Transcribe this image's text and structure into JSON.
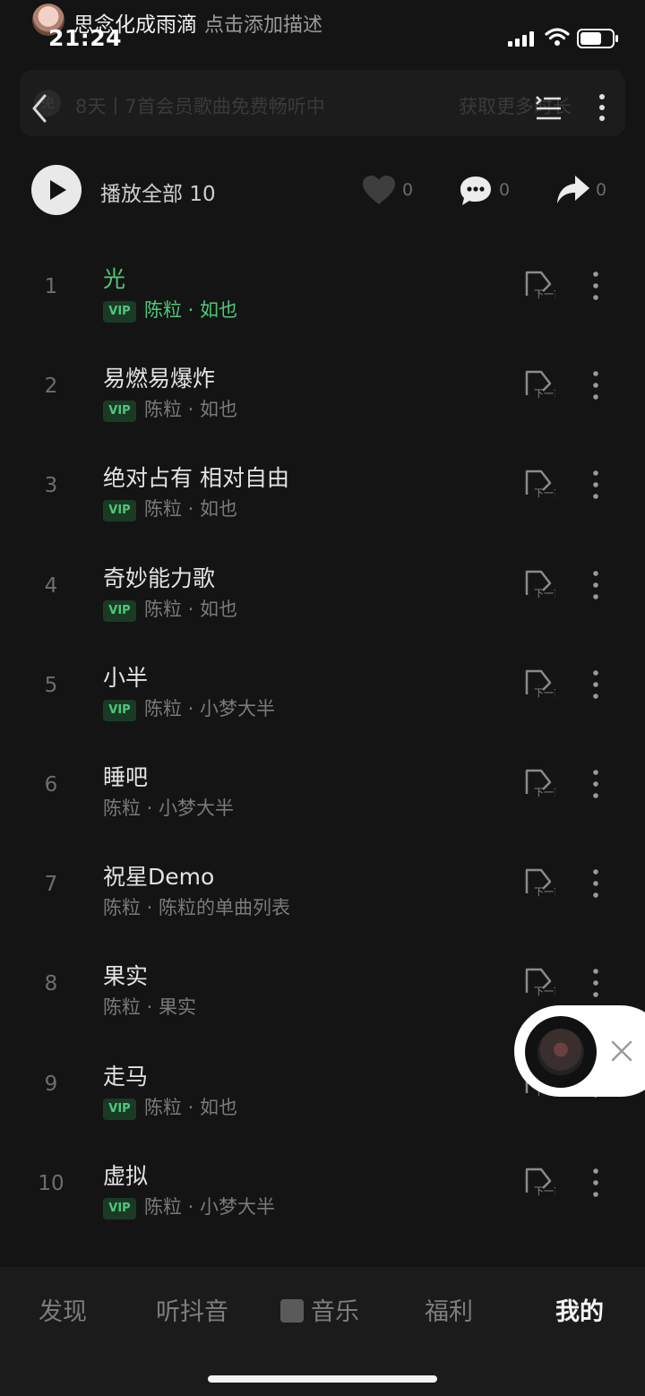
{
  "status": {
    "time": "21:24"
  },
  "header": {
    "user_name": "思念化成雨滴",
    "description": "点击添加描述"
  },
  "banner": {
    "text": "8天丨7首会员歌曲免费畅听中",
    "cta": "获取更多时长"
  },
  "actions": {
    "play_all_label": "播放全部",
    "play_all_count": "10",
    "like_count": "0",
    "comment_count": "0",
    "share_count": "0"
  },
  "songs": [
    {
      "index": "1",
      "title": "光",
      "vip": true,
      "vip_label": "VIP",
      "artist_album": "陈粒 · 如也",
      "playing": true
    },
    {
      "index": "2",
      "title": "易燃易爆炸",
      "vip": true,
      "vip_label": "VIP",
      "artist_album": "陈粒 · 如也"
    },
    {
      "index": "3",
      "title": "绝对占有 相对自由",
      "vip": true,
      "vip_label": "VIP",
      "artist_album": "陈粒 · 如也"
    },
    {
      "index": "4",
      "title": "奇妙能力歌",
      "vip": true,
      "vip_label": "VIP",
      "artist_album": "陈粒 · 如也"
    },
    {
      "index": "5",
      "title": "小半",
      "vip": true,
      "vip_label": "VIP",
      "artist_album": "陈粒 · 小梦大半"
    },
    {
      "index": "6",
      "title": "睡吧",
      "vip": false,
      "artist_album": "陈粒 · 小梦大半"
    },
    {
      "index": "7",
      "title": "祝星Demo",
      "vip": false,
      "artist_album": "陈粒 · 陈粒的单曲列表"
    },
    {
      "index": "8",
      "title": "果实",
      "vip": false,
      "artist_album": "陈粒 · 果实"
    },
    {
      "index": "9",
      "title": "走马",
      "vip": true,
      "vip_label": "VIP",
      "artist_album": "陈粒 · 如也"
    },
    {
      "index": "10",
      "title": "虚拟",
      "vip": true,
      "vip_label": "VIP",
      "artist_album": "陈粒 · 小梦大半"
    }
  ],
  "tabs": [
    {
      "label": "发现"
    },
    {
      "label": "听抖音"
    },
    {
      "label": "音乐"
    },
    {
      "label": "福利"
    },
    {
      "label": "我的",
      "selected": true
    }
  ],
  "icons": {
    "next_play": "play-next-icon",
    "more": "more-vertical-icon",
    "like": "heart-icon",
    "comment": "comment-icon",
    "share": "share-icon"
  },
  "colors": {
    "accent": "#4fc87a",
    "background": "#141414"
  }
}
